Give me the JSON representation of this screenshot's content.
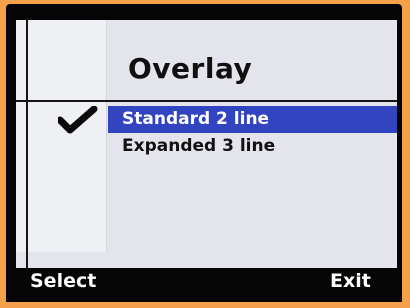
{
  "screen": {
    "title": "Overlay",
    "options": [
      {
        "label": "Standard 2 line",
        "checked": true,
        "highlighted": true
      },
      {
        "label": "Expanded 3 line",
        "checked": false,
        "highlighted": false
      }
    ],
    "check_icon": "checkmark-icon"
  },
  "softkeys": {
    "left_label": "Select",
    "right_label": "Exit"
  },
  "colors": {
    "background": "#f5a04a",
    "bezel": "#050505",
    "screen": "#e4e4ec",
    "highlight": "#3344c0"
  }
}
